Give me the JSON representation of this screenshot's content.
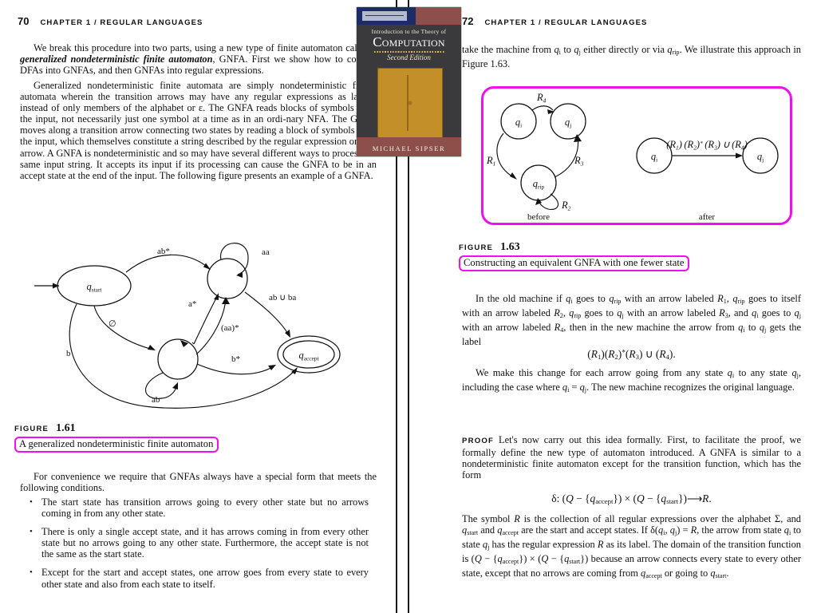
{
  "left_page": {
    "running_head": {
      "page_number": "70",
      "chapter": "CHAPTER 1 / REGULAR LANGUAGES"
    },
    "para1_html": "We break this procedure into two parts, using a new type of finite automaton called a <span class=\"bi\">generalized nondeterministic finite automaton</span>, GNFA. First we show how to convert DFAs into GNFAs, and then GNFAs into regular expressions.",
    "para2_html": "Generalized nondeterministic finite automata are simply nondeterministic fi-nite automata wherein the transition arrows may have any regular expressions as labels, instead of only members of the alphabet or &#949;. The GNFA reads blocks of symbols from the input, not necessarily just one symbol at a time as in an ordi-nary NFA. The GNFA moves along a transition arrow connecting two states by reading a block of symbols from the input, which themselves constitute a string described by the regular expression on that arrow. A GNFA is nondeterministic and so may have several different ways to process the same input string. It accepts its input if its processing can cause the GNFA to be in an accept state at the end of the input. The following figure presents an example of a GNFA.",
    "figure": {
      "label": "FIGURE",
      "number": "1.61",
      "caption": "A generalized nondeterministic finite automaton",
      "states": [
        {
          "id": "qstart",
          "label": "q",
          "sub": "start",
          "shape": "ellipse"
        },
        {
          "id": "q1",
          "label": "",
          "sub": "",
          "shape": "circle"
        },
        {
          "id": "q2",
          "label": "",
          "sub": "",
          "shape": "circle"
        },
        {
          "id": "qaccept",
          "label": "q",
          "sub": "accept",
          "shape": "double-ellipse"
        }
      ],
      "transitions": [
        {
          "from": "qstart",
          "to": "q1",
          "label": "ab*"
        },
        {
          "from": "q1",
          "to": "q1",
          "label": "aa"
        },
        {
          "from": "qstart",
          "to": "q2",
          "label": "∅"
        },
        {
          "from": "qstart",
          "to": "qaccept",
          "label": "b"
        },
        {
          "from": "q2",
          "to": "q1",
          "label": "a*"
        },
        {
          "from": "q1",
          "to": "q2",
          "label": "(aa)*"
        },
        {
          "from": "q1",
          "to": "qaccept",
          "label": "ab ∪ ba"
        },
        {
          "from": "q2",
          "to": "qaccept",
          "label": "b*"
        },
        {
          "from": "q2",
          "to": "q2",
          "label": "ab"
        }
      ]
    },
    "para3_html": "For convenience we require that GNFAs always have a special form that meets the following conditions.",
    "bullets": [
      "The start state has transition arrows going to every other state but no arrows coming in from any other state.",
      "There is only a single accept state, and it has arrows coming in from every other state but no arrows going to any other state. Furthermore, the accept state is not the same as the start state.",
      "Except for the start and accept states, one arrow goes from every state to every other state and also from each state to itself."
    ]
  },
  "book_cover": {
    "title_line1": "Introduction to the Theory of",
    "title_line2": "Computation",
    "edition": "Second Edition",
    "author": "MICHAEL SIPSER"
  },
  "right_page": {
    "running_head": {
      "page_number": "72",
      "chapter": "CHAPTER 1 / REGULAR LANGUAGES"
    },
    "para1_html": "take the machine from <span class=\"mi\">q<sub class=\"s\">i</sub></span> to <span class=\"mi\">q<sub class=\"s\">j</sub></span> either directly or via <span class=\"mi\">q<sub class=\"s\">rip</sub></span>. We illustrate this approach in Figure 1.63.",
    "figure": {
      "label": "FIGURE",
      "number": "1.63",
      "caption": "Constructing an equivalent GNFA with one fewer state",
      "before_label": "before",
      "after_label": "after",
      "before_states": [
        {
          "id": "qi",
          "label": "q",
          "sub": "i"
        },
        {
          "id": "qj",
          "label": "q",
          "sub": "j"
        },
        {
          "id": "qrip",
          "label": "q",
          "sub": "rip"
        }
      ],
      "before_transitions": [
        {
          "from": "qi",
          "to": "qj",
          "label": "R",
          "sub": "4"
        },
        {
          "from": "qi",
          "to": "qrip",
          "label": "R",
          "sub": "1"
        },
        {
          "from": "qrip",
          "to": "qrip",
          "label": "R",
          "sub": "2"
        },
        {
          "from": "qrip",
          "to": "qj",
          "label": "R",
          "sub": "3"
        }
      ],
      "after_states": [
        {
          "id": "qi",
          "label": "q",
          "sub": "i"
        },
        {
          "id": "qj",
          "label": "q",
          "sub": "j"
        }
      ],
      "after_transition_label": "(R1) (R2)* (R3) ∪ (R4)"
    },
    "para2_html": "In the old machine if <span class=\"mi\">q<sub class=\"s\">i</sub></span> goes to <span class=\"mi\">q<sub class=\"s\">rip</sub></span> with an arrow labeled <span class=\"mi\">R<sub class=\"s\">1</sub></span>, <span class=\"mi\">q<sub class=\"s\">rip</sub></span> goes to itself with an arrow labeled <span class=\"mi\">R<sub class=\"s\">2</sub></span>, <span class=\"mi\">q<sub class=\"s\">rip</sub></span> goes to <span class=\"mi\">q<sub class=\"s\">j</sub></span> with an arrow labeled <span class=\"mi\">R<sub class=\"s\">3</sub></span>, and <span class=\"mi\">q<sub class=\"s\">i</sub></span> goes to <span class=\"mi\">q<sub class=\"s\">j</sub></span> with an arrow labeled <span class=\"mi\">R<sub class=\"s\">4</sub></span>, then in the new machine the arrow from <span class=\"mi\">q<sub class=\"s\">i</sub></span> to <span class=\"mi\">q<sub class=\"s\">j</sub></span> gets the label",
    "display_math_1_html": "(<span class=\"mi\">R<sub class=\"s\">1</sub></span>)(<span class=\"mi\">R<sub class=\"s\">2</sub></span>)<sup class=\"s\">*</sup>(<span class=\"mi\">R<sub class=\"s\">3</sub></span>) &#8746; (<span class=\"mi\">R<sub class=\"s\">4</sub></span>).",
    "para3_html": "We make this change for each arrow going from any state <span class=\"mi\">q<sub class=\"s\">i</sub></span> to any state <span class=\"mi\">q<sub class=\"s\">j</sub></span>, including the case where <span class=\"mi\">q<sub class=\"s\">i</sub></span> = <span class=\"mi\">q<sub class=\"s\">j</sub></span>. The new machine recognizes the original language.",
    "proof_label": "PROOF",
    "para4_html": "Let's now carry out this idea formally. First, to facilitate the proof, we formally define the new type of automaton introduced. A GNFA is similar to a nondeterministic finite automaton except for the transition function, which has the form",
    "display_math_2_html": "&#948;: (<span class=\"mi\">Q</span> &#8722; {<span class=\"mi\">q<sub class=\"s\">accept</sub></span>}) &#215; (<span class=\"mi\">Q</span> &#8722; {<span class=\"mi\">q<sub class=\"s\">start</sub></span>})&#10230;<span class=\"cal\">R</span>.",
    "para5_html": "The symbol <span class=\"cal\">R</span> is the collection of all regular expressions over the alphabet &#931;, and <span class=\"mi\">q<sub class=\"s\">start</sub></span> and <span class=\"mi\">q<sub class=\"s\">accept</sub></span> are the start and accept states. If &#948;(<span class=\"mi\">q<sub class=\"s\">i</sub></span>, <span class=\"mi\">q<sub class=\"s\">j</sub></span>) = <span class=\"mi\">R</span>, the arrow from state <span class=\"mi\">q<sub class=\"s\">i</sub></span> to state <span class=\"mi\">q<sub class=\"s\">j</sub></span> has the regular expression <span class=\"mi\">R</span> as its label. The domain of the transition function is (<span class=\"mi\">Q</span> &#8722; {<span class=\"mi\">q<sub class=\"s\">accept</sub></span>}) &#215; (<span class=\"mi\">Q</span> &#8722; {<span class=\"mi\">q<sub class=\"s\">start</sub></span>}) because an arrow connects every state to every other state, except that no arrows are coming from <span class=\"mi\">q<sub class=\"s\">accept</sub></span> or going to <span class=\"mi\">q<sub class=\"s\">start</sub></span>."
  },
  "colors": {
    "highlight": "#ef0fef",
    "ink": "#111111",
    "paper": "#ffffff"
  }
}
